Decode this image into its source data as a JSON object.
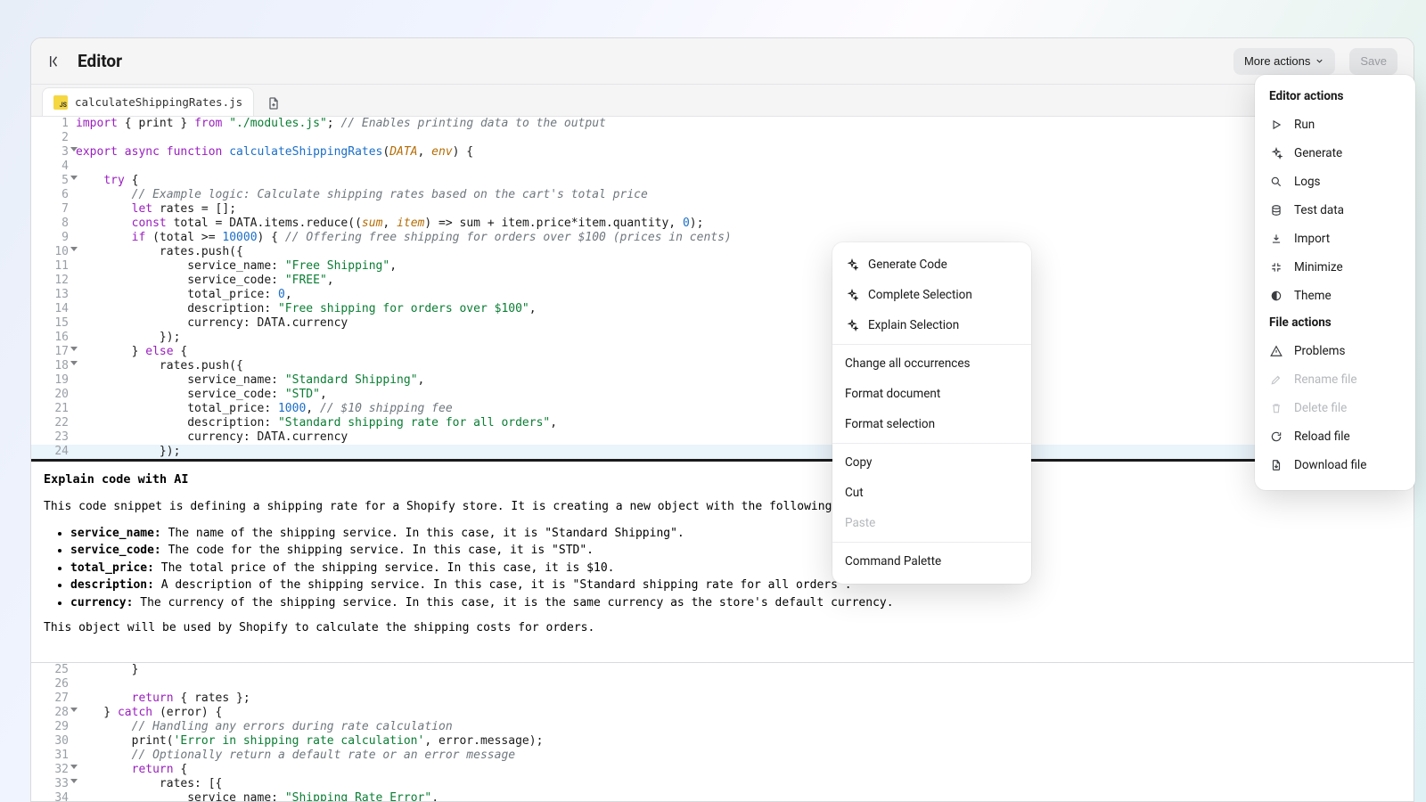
{
  "header": {
    "title": "Editor",
    "more_actions": "More actions",
    "save": "Save"
  },
  "tab": {
    "filename": "calculateShippingRates.js"
  },
  "code": {
    "lines": [
      {
        "n": 1,
        "tokens": [
          {
            "t": "import ",
            "c": "k-kw"
          },
          {
            "t": "{ ",
            "c": "k-punc"
          },
          {
            "t": "print",
            "c": ""
          },
          {
            "t": " } ",
            "c": "k-punc"
          },
          {
            "t": "from ",
            "c": "k-kw"
          },
          {
            "t": "\"./modules.js\"",
            "c": "k-str"
          },
          {
            "t": ";",
            "c": "k-punc"
          },
          {
            "t": " // Enables printing data to the output",
            "c": "k-cmt"
          }
        ]
      },
      {
        "n": 2,
        "tokens": []
      },
      {
        "n": 3,
        "fold": true,
        "tokens": [
          {
            "t": "export async function ",
            "c": "k-kw"
          },
          {
            "t": "calculateShippingRates",
            "c": "k-fn"
          },
          {
            "t": "(",
            "c": "k-punc"
          },
          {
            "t": "DATA",
            "c": "k-par"
          },
          {
            "t": ", ",
            "c": "k-punc"
          },
          {
            "t": "env",
            "c": "k-par"
          },
          {
            "t": ") {",
            "c": "k-punc"
          }
        ]
      },
      {
        "n": 4,
        "tokens": []
      },
      {
        "n": 5,
        "fold": true,
        "tokens": [
          {
            "t": "    ",
            "c": ""
          },
          {
            "t": "try ",
            "c": "k-kw"
          },
          {
            "t": "{",
            "c": "k-punc"
          }
        ]
      },
      {
        "n": 6,
        "tokens": [
          {
            "t": "        ",
            "c": ""
          },
          {
            "t": "// Example logic: Calculate shipping rates based on the cart's total price",
            "c": "k-cmt"
          }
        ]
      },
      {
        "n": 7,
        "tokens": [
          {
            "t": "        ",
            "c": ""
          },
          {
            "t": "let ",
            "c": "k-kw"
          },
          {
            "t": "rates = [];",
            "c": ""
          }
        ]
      },
      {
        "n": 8,
        "tokens": [
          {
            "t": "        ",
            "c": ""
          },
          {
            "t": "const ",
            "c": "k-kw"
          },
          {
            "t": "total = DATA.items.reduce((",
            "c": ""
          },
          {
            "t": "sum",
            "c": "k-par"
          },
          {
            "t": ", ",
            "c": ""
          },
          {
            "t": "item",
            "c": "k-par"
          },
          {
            "t": ") => sum + item.price*item.quantity, ",
            "c": ""
          },
          {
            "t": "0",
            "c": "k-num"
          },
          {
            "t": ");",
            "c": ""
          }
        ]
      },
      {
        "n": 9,
        "tokens": [
          {
            "t": "        ",
            "c": ""
          },
          {
            "t": "if ",
            "c": "k-kw"
          },
          {
            "t": "(total >= ",
            "c": ""
          },
          {
            "t": "10000",
            "c": "k-num"
          },
          {
            "t": ") { ",
            "c": ""
          },
          {
            "t": "// Offering free shipping for orders over $100 (prices in cents)",
            "c": "k-cmt"
          }
        ]
      },
      {
        "n": 10,
        "fold": true,
        "tokens": [
          {
            "t": "            rates.push({",
            "c": ""
          }
        ]
      },
      {
        "n": 11,
        "tokens": [
          {
            "t": "                service_name: ",
            "c": ""
          },
          {
            "t": "\"Free Shipping\"",
            "c": "k-str"
          },
          {
            "t": ",",
            "c": ""
          }
        ]
      },
      {
        "n": 12,
        "tokens": [
          {
            "t": "                service_code: ",
            "c": ""
          },
          {
            "t": "\"FREE\"",
            "c": "k-str"
          },
          {
            "t": ",",
            "c": ""
          }
        ]
      },
      {
        "n": 13,
        "tokens": [
          {
            "t": "                total_price: ",
            "c": ""
          },
          {
            "t": "0",
            "c": "k-num"
          },
          {
            "t": ",",
            "c": ""
          }
        ]
      },
      {
        "n": 14,
        "tokens": [
          {
            "t": "                description: ",
            "c": ""
          },
          {
            "t": "\"Free shipping for orders over $100\"",
            "c": "k-str"
          },
          {
            "t": ",",
            "c": ""
          }
        ]
      },
      {
        "n": 15,
        "tokens": [
          {
            "t": "                currency: DATA.currency",
            "c": ""
          }
        ]
      },
      {
        "n": 16,
        "tokens": [
          {
            "t": "            });",
            "c": ""
          }
        ]
      },
      {
        "n": 17,
        "fold": true,
        "tokens": [
          {
            "t": "        } ",
            "c": ""
          },
          {
            "t": "else ",
            "c": "k-kw"
          },
          {
            "t": "{",
            "c": ""
          }
        ]
      },
      {
        "n": 18,
        "fold": true,
        "tokens": [
          {
            "t": "            rates.push({",
            "c": ""
          }
        ]
      },
      {
        "n": 19,
        "tokens": [
          {
            "t": "                service_name: ",
            "c": ""
          },
          {
            "t": "\"Standard Shipping\"",
            "c": "k-str"
          },
          {
            "t": ",",
            "c": ""
          }
        ]
      },
      {
        "n": 20,
        "tokens": [
          {
            "t": "                service_code: ",
            "c": ""
          },
          {
            "t": "\"STD\"",
            "c": "k-str"
          },
          {
            "t": ",",
            "c": ""
          }
        ]
      },
      {
        "n": 21,
        "tokens": [
          {
            "t": "                total_price: ",
            "c": ""
          },
          {
            "t": "1000",
            "c": "k-num"
          },
          {
            "t": ", ",
            "c": ""
          },
          {
            "t": "// $10 shipping fee",
            "c": "k-cmt"
          }
        ]
      },
      {
        "n": 22,
        "tokens": [
          {
            "t": "                description: ",
            "c": ""
          },
          {
            "t": "\"Standard shipping rate for all orders\"",
            "c": "k-str"
          },
          {
            "t": ",",
            "c": ""
          }
        ]
      },
      {
        "n": 23,
        "tokens": [
          {
            "t": "                currency: DATA.currency",
            "c": ""
          }
        ]
      },
      {
        "n": 24,
        "cursor": true,
        "tokens": [
          {
            "t": "            });",
            "c": ""
          }
        ]
      }
    ],
    "lines2": [
      {
        "n": 25,
        "tokens": [
          {
            "t": "        }",
            "c": ""
          }
        ]
      },
      {
        "n": 26,
        "tokens": []
      },
      {
        "n": 27,
        "tokens": [
          {
            "t": "        ",
            "c": ""
          },
          {
            "t": "return ",
            "c": "k-kw"
          },
          {
            "t": "{ rates };",
            "c": ""
          }
        ]
      },
      {
        "n": 28,
        "fold": true,
        "tokens": [
          {
            "t": "    } ",
            "c": ""
          },
          {
            "t": "catch ",
            "c": "k-kw"
          },
          {
            "t": "(error) {",
            "c": ""
          }
        ]
      },
      {
        "n": 29,
        "tokens": [
          {
            "t": "        ",
            "c": ""
          },
          {
            "t": "// Handling any errors during rate calculation",
            "c": "k-cmt"
          }
        ]
      },
      {
        "n": 30,
        "tokens": [
          {
            "t": "        print(",
            "c": ""
          },
          {
            "t": "'Error in shipping rate calculation'",
            "c": "k-str"
          },
          {
            "t": ", error.message);",
            "c": ""
          }
        ]
      },
      {
        "n": 31,
        "tokens": [
          {
            "t": "        ",
            "c": ""
          },
          {
            "t": "// Optionally return a default rate or an error message",
            "c": "k-cmt"
          }
        ]
      },
      {
        "n": 32,
        "fold": true,
        "tokens": [
          {
            "t": "        ",
            "c": ""
          },
          {
            "t": "return ",
            "c": "k-kw"
          },
          {
            "t": "{",
            "c": ""
          }
        ]
      },
      {
        "n": 33,
        "fold": true,
        "tokens": [
          {
            "t": "            rates: [{",
            "c": ""
          }
        ]
      },
      {
        "n": 34,
        "tokens": [
          {
            "t": "                service_name: ",
            "c": ""
          },
          {
            "t": "\"Shipping Rate Error\"",
            "c": "k-str"
          },
          {
            "t": ",",
            "c": ""
          }
        ]
      }
    ]
  },
  "explain": {
    "title": "Explain code with AI",
    "intro": "This code snippet is defining a shipping rate for a Shopify store. It is creating a new object with the following propert",
    "bullets": [
      {
        "key": "service_name:",
        "text": " The name of the shipping service. In this case, it is \"Standard Shipping\"."
      },
      {
        "key": "service_code:",
        "text": " The code for the shipping service. In this case, it is \"STD\"."
      },
      {
        "key": "total_price:",
        "text": " The total price of the shipping service. In this case, it is $10."
      },
      {
        "key": "description:",
        "text": " A description of the shipping service. In this case, it is \"Standard shipping rate for all orders\"."
      },
      {
        "key": "currency:",
        "text": " The currency of the shipping service. In this case, it is the same currency as the store's default currency."
      }
    ],
    "outro": "This object will be used by Shopify to calculate the shipping costs for orders."
  },
  "context_menu": [
    {
      "label": "Generate Code",
      "icon": "sparkle"
    },
    {
      "label": "Complete Selection",
      "icon": "sparkle"
    },
    {
      "label": "Explain Selection",
      "icon": "sparkle"
    },
    {
      "sep": true
    },
    {
      "label": "Change all occurrences"
    },
    {
      "label": "Format document"
    },
    {
      "label": "Format selection"
    },
    {
      "sep": true
    },
    {
      "label": "Copy"
    },
    {
      "label": "Cut"
    },
    {
      "label": "Paste",
      "disabled": true
    },
    {
      "sep": true
    },
    {
      "label": "Command Palette"
    }
  ],
  "actions_panel": {
    "sec1": "Editor actions",
    "sec1_items": [
      {
        "label": "Run",
        "icon": "play"
      },
      {
        "label": "Generate",
        "icon": "sparkle"
      },
      {
        "label": "Logs",
        "icon": "zoom"
      },
      {
        "label": "Test data",
        "icon": "db"
      },
      {
        "label": "Import",
        "icon": "download"
      },
      {
        "label": "Minimize",
        "icon": "minimize"
      },
      {
        "label": "Theme",
        "icon": "theme"
      }
    ],
    "sec2": "File actions",
    "sec2_items": [
      {
        "label": "Problems",
        "icon": "warn"
      },
      {
        "label": "Rename file",
        "icon": "pencil",
        "disabled": true
      },
      {
        "label": "Delete file",
        "icon": "trash",
        "disabled": true
      },
      {
        "label": "Reload file",
        "icon": "reload"
      },
      {
        "label": "Download file",
        "icon": "download2"
      }
    ]
  }
}
